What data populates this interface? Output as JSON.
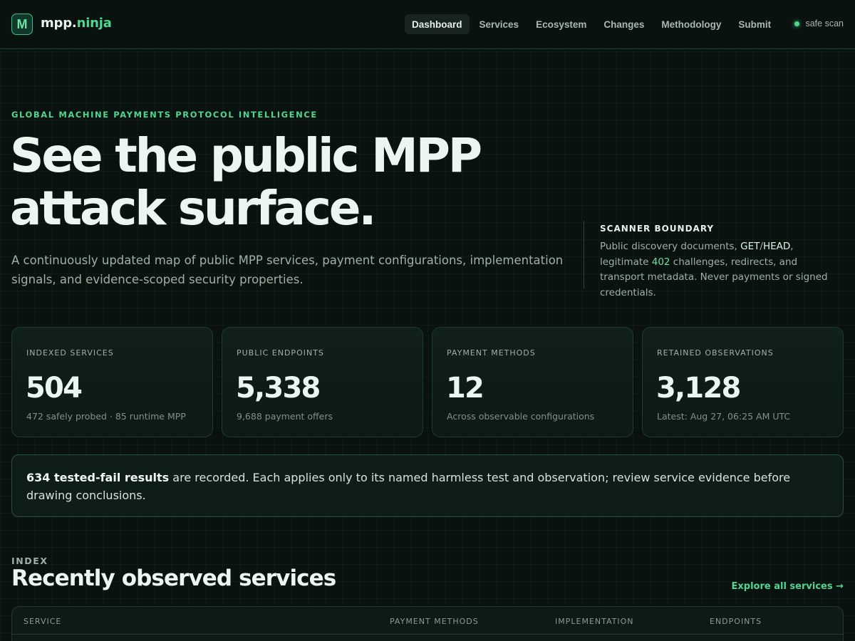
{
  "header": {
    "logo_mark": "M",
    "brand_prefix": "mpp.",
    "brand_suffix": "ninja",
    "nav": [
      "Dashboard",
      "Services",
      "Ecosystem",
      "Changes",
      "Methodology",
      "Submit"
    ],
    "active_nav": "Dashboard",
    "status": "safe scan"
  },
  "hero": {
    "eyebrow": "GLOBAL MACHINE PAYMENTS PROTOCOL INTELLIGENCE",
    "title_line1": "See the public MPP",
    "title_line2": "attack surface.",
    "subtitle": "A continuously updated map of public MPP services, payment configurations, implementation signals, and evidence-scoped security properties."
  },
  "boundary": {
    "title": "SCANNER BOUNDARY",
    "text_1": "Public discovery documents, ",
    "get": "GET",
    "slash": "/",
    "head": "HEAD",
    "text_2": ", legitimate ",
    "code": "402",
    "text_3": " challenges, redirects, and transport metadata. Never payments or signed credentials."
  },
  "stats": [
    {
      "label": "INDEXED SERVICES",
      "value": "504",
      "note": "472 safely probed · 85 runtime MPP"
    },
    {
      "label": "PUBLIC ENDPOINTS",
      "value": "5,338",
      "note": "9,688 payment offers"
    },
    {
      "label": "PAYMENT METHODS",
      "value": "12",
      "note": "Across observable configurations"
    },
    {
      "label": "RETAINED OBSERVATIONS",
      "value": "3,128",
      "note": "Latest: Aug 27, 06:25 AM UTC"
    }
  ],
  "notice": {
    "bold": "634 tested-fail results",
    "text": " are recorded. Each applies only to its named harmless test and observation; review service evidence before drawing conclusions."
  },
  "index": {
    "eyebrow": "INDEX",
    "title": "Recently observed services",
    "explore_link": "Explore all services →",
    "columns": [
      "SERVICE",
      "PAYMENT METHODS",
      "IMPLEMENTATION",
      "ENDPOINTS"
    ]
  },
  "colors": {
    "accent": "#4fd690",
    "background": "#0a1210",
    "card": "#10201a",
    "border": "#1f3a2e"
  }
}
